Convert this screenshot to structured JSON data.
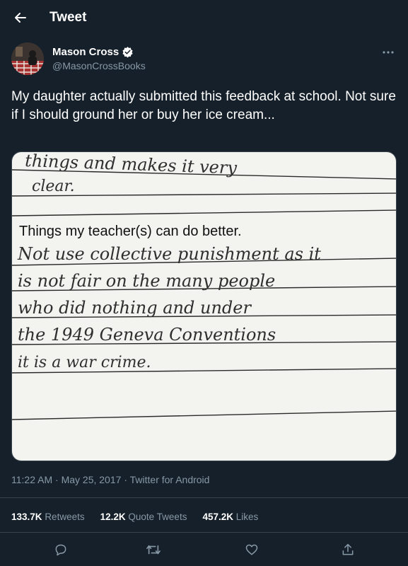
{
  "header": {
    "title": "Tweet"
  },
  "author": {
    "name": "Mason Cross",
    "handle": "@MasonCrossBooks"
  },
  "tweet": {
    "text": "My daughter actually submitted this feedback at school. Not sure if I should ground her or buy her ice cream...",
    "time": "11:22 AM",
    "date": "May 25, 2017",
    "source": "Twitter for Android"
  },
  "media": {
    "top_line_1": "things and makes it very",
    "top_line_2": "clear.",
    "printed_heading": "Things my teacher(s)  can do better.",
    "handwriting": [
      "Not use collective punishment as it",
      "is not fair on the many people",
      "who did nothing and under",
      "the 1949 Geneva Conventions",
      "it is a war crime."
    ]
  },
  "stats": {
    "retweets_count": "133.7K",
    "retweets_label": "Retweets",
    "quotes_count": "12.2K",
    "quotes_label": "Quote Tweets",
    "likes_count": "457.2K",
    "likes_label": "Likes"
  },
  "colors": {
    "background": "#15202b",
    "text": "#ffffff",
    "secondary": "#8899a6",
    "border": "#38444d"
  },
  "icons": [
    "back-arrow-icon",
    "verified-badge-icon",
    "more-icon",
    "reply-icon",
    "retweet-icon",
    "like-icon",
    "share-icon"
  ]
}
